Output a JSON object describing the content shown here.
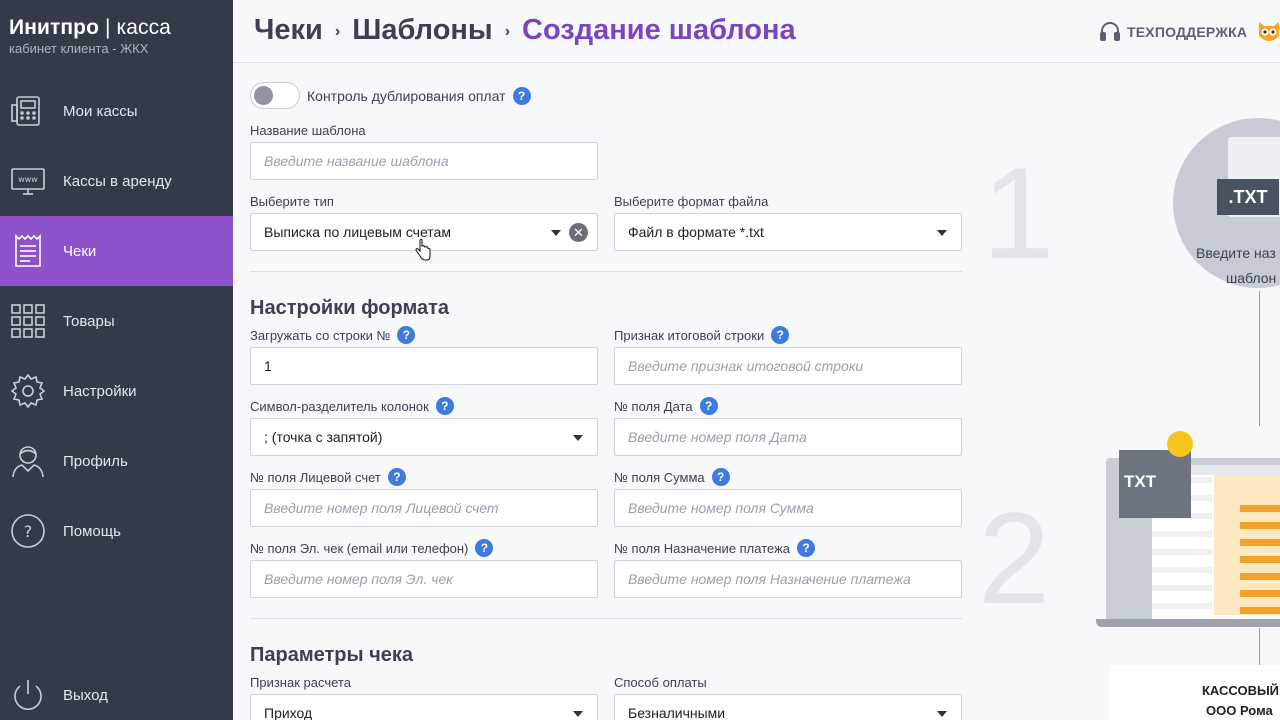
{
  "brand": {
    "name_bold": "Инитпро",
    "name_sep": " | ",
    "name_rest": "касса",
    "subtitle": "кабинет клиента - ЖКХ"
  },
  "sidebar": {
    "items": [
      {
        "label": "Мои кассы",
        "icon": "cash-register-icon"
      },
      {
        "label": "Кассы в аренду",
        "icon": "www-monitor-icon"
      },
      {
        "label": "Чеки",
        "icon": "receipt-icon",
        "active": true
      },
      {
        "label": "Товары",
        "icon": "grid-icon"
      },
      {
        "label": "Настройки",
        "icon": "gear-icon"
      },
      {
        "label": "Профиль",
        "icon": "user-icon"
      },
      {
        "label": "Помощь",
        "icon": "help-icon"
      }
    ],
    "logout": "Выход"
  },
  "header": {
    "crumbs": [
      "Чеки",
      "Шаблоны",
      "Создание шаблона"
    ],
    "support": "ТЕХПОДДЕРЖКА"
  },
  "form": {
    "dup_toggle_label": "Контроль дублирования оплат",
    "template_name_label": "Название шаблона",
    "template_name_placeholder": "Введите название шаблона",
    "type_label": "Выберите тип",
    "type_value": "Выписка по лицевым счетам",
    "format_label": "Выберите формат файла",
    "format_value": "Файл в формате *.txt",
    "section_format": "Настройки формата",
    "start_row_label": "Загружать со строки №",
    "start_row_value": "1",
    "total_label": "Признак итоговой строки",
    "total_placeholder": "Введите признак итоговой строки",
    "sep_label": "Символ-разделитель колонок",
    "sep_value": "; (точка с запятой)",
    "date_label": "№ поля Дата",
    "date_placeholder": "Введите номер поля Дата",
    "account_label": "№ поля Лицевой счет",
    "account_placeholder": "Введите номер поля Лицевой счет",
    "sum_label": "№ поля Сумма",
    "sum_placeholder": "Введите номер поля Сумма",
    "echeck_label": "№ поля Эл. чек (email или телефон)",
    "echeck_placeholder": "Введите номер поля Эл. чек",
    "purpose_label": "№ поля Назначение платежа",
    "purpose_placeholder": "Введите номер поля Назначение платежа",
    "section_receipt": "Параметры чека",
    "calc_label": "Признак расчета",
    "calc_value": "Приход",
    "pay_label": "Способ оплаты",
    "pay_value": "Безналичными"
  },
  "illustration": {
    "step1": "1",
    "step2": "2",
    "file_badge": ".TXT",
    "hint_line1": "Введите наз",
    "hint_line2": "шаблон",
    "txt_badge": "TXT",
    "caption_line1": "КАССОВЫЙ",
    "caption_line2": "ООО Рома"
  },
  "colors": {
    "sidebar": "#343a48",
    "accent": "#8b52c9",
    "crumb_current": "#7b44c0",
    "help": "#3d7be0"
  }
}
